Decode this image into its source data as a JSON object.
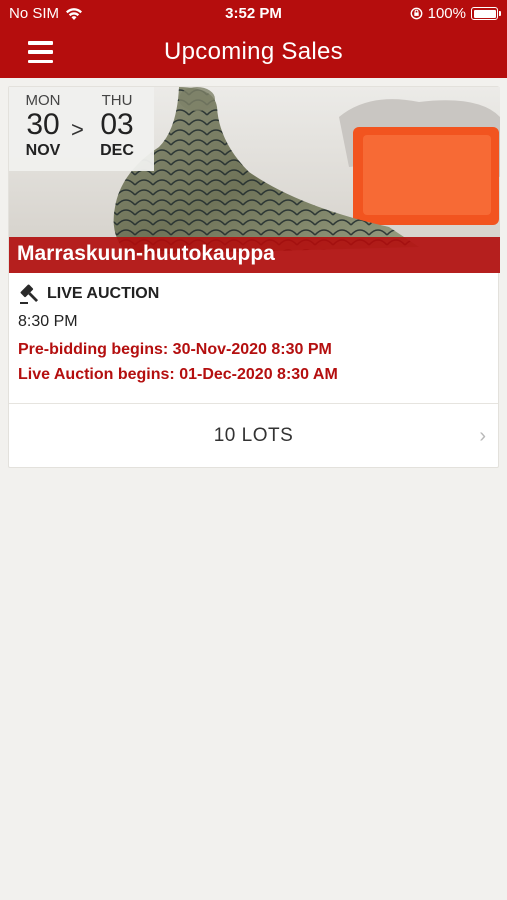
{
  "status_bar": {
    "carrier": "No SIM",
    "time": "3:52 PM",
    "battery": "100%"
  },
  "nav": {
    "title": "Upcoming Sales",
    "menu_icon": "hamburger-menu-icon"
  },
  "sale": {
    "start": {
      "dow": "MON",
      "day": "30",
      "month": "NOV"
    },
    "separator": ">",
    "end": {
      "dow": "THU",
      "day": "03",
      "month": "DEC"
    },
    "title": "Marraskuun-huutokauppa",
    "type_icon": "gavel-icon",
    "type": "LIVE AUCTION",
    "time": "8:30 PM",
    "prebidding": "Pre-bidding begins: 30-Nov-2020 8:30 PM",
    "live": "Live Auction begins: 01-Dec-2020 8:30 AM",
    "lots": "10 LOTS",
    "chevron": "›"
  },
  "colors": {
    "brand": "#b50d0d",
    "accent_text": "#b40f0f",
    "background": "#f2f1ee"
  }
}
